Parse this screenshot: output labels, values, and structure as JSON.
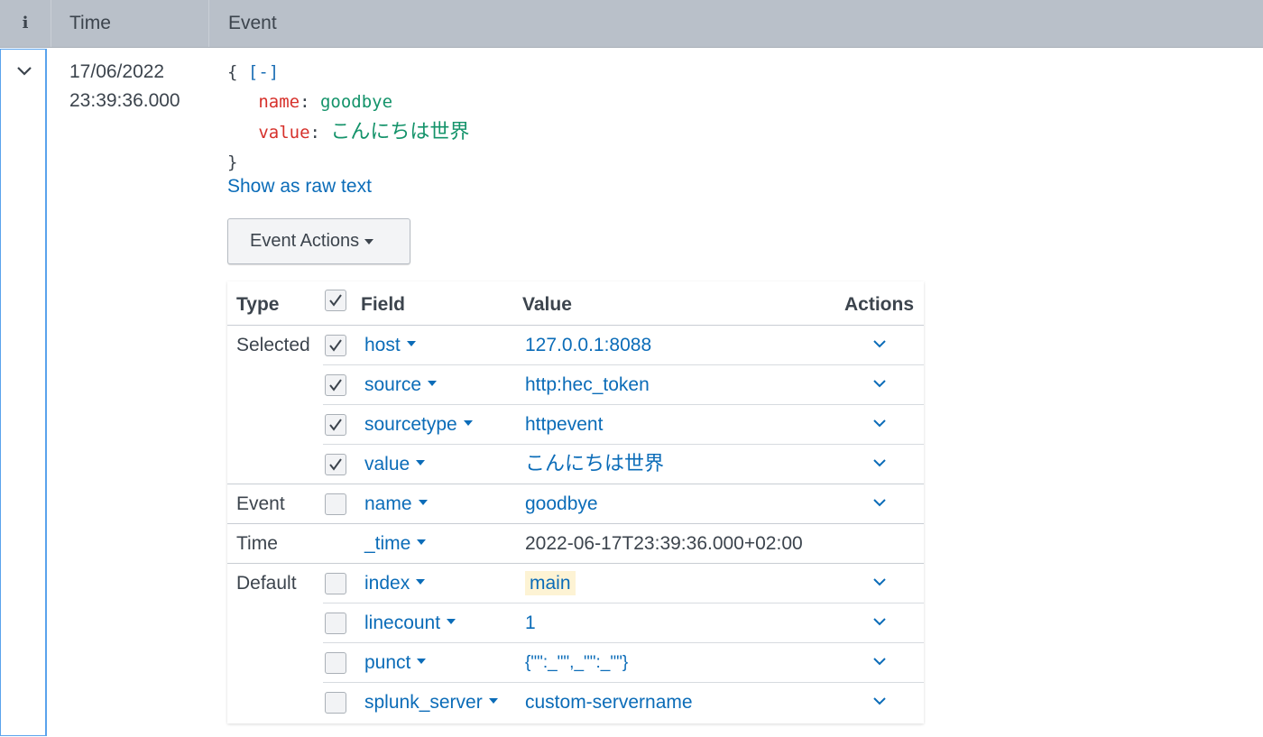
{
  "header": {
    "info_label": "i",
    "time_label": "Time",
    "event_label": "Event"
  },
  "event": {
    "date": "17/06/2022",
    "time": "23:39:36.000",
    "json": {
      "open": "{",
      "toggle": "[-]",
      "fields": [
        {
          "key": "name",
          "value": "goodbye"
        },
        {
          "key": "value",
          "value": "こんにちは世界"
        }
      ],
      "close": "}"
    },
    "raw_link": "Show as raw text",
    "actions_button": "Event Actions"
  },
  "fields_table": {
    "headers": {
      "type": "Type",
      "field": "Field",
      "value": "Value",
      "actions": "Actions"
    },
    "groups": [
      {
        "type": "Selected",
        "rows": [
          {
            "field": "host",
            "value": "127.0.0.1:8088",
            "checked": true
          },
          {
            "field": "source",
            "value": "http:hec_token",
            "checked": true
          },
          {
            "field": "sourcetype",
            "value": "httpevent",
            "checked": true
          },
          {
            "field": "value",
            "value": "こんにちは世界",
            "checked": true
          }
        ]
      },
      {
        "type": "Event",
        "rows": [
          {
            "field": "name",
            "value": "goodbye",
            "checked": false
          }
        ]
      },
      {
        "type": "Time",
        "rows": [
          {
            "field": "_time",
            "value": "2022-06-17T23:39:36.000+02:00"
          }
        ]
      },
      {
        "type": "Default",
        "rows": [
          {
            "field": "index",
            "value": "main",
            "checked": false
          },
          {
            "field": "linecount",
            "value": "1",
            "checked": false
          },
          {
            "field": "punct",
            "value": "{\"\":_\"\",_\"\":_\"\"}",
            "checked": false
          },
          {
            "field": "splunk_server",
            "value": "custom-servername",
            "checked": false
          }
        ]
      }
    ]
  },
  "colors": {
    "header_bg": "#b9c0c9",
    "link": "#0b6cb8",
    "json_key": "#d6312b",
    "json_value": "#14936a",
    "expand_border": "#5aa3ec",
    "highlight_bg": "#fdf3d4"
  }
}
